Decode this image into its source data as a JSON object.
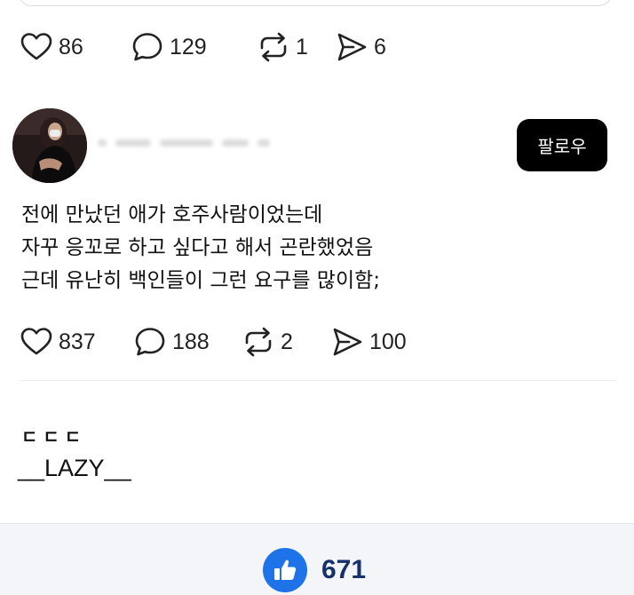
{
  "previous_post": {
    "actions": {
      "likes": "86",
      "comments": "129",
      "reposts": "1",
      "shares": "6"
    }
  },
  "post": {
    "follow_label": "팔로우",
    "lines": [
      "전에 만났던 애가 호주사람이었는데",
      "자꾸 응꼬로 하고 싶다고 해서 곤란했었음",
      "근데 유난히 백인들이 그런 요구를 많이함;"
    ],
    "actions": {
      "likes": "837",
      "comments": "188",
      "reposts": "2",
      "shares": "100"
    }
  },
  "comment": {
    "text": "ㄷㄷㄷ",
    "author": "__LAZY__"
  },
  "bottom_bar": {
    "like_count": "671",
    "accent_color": "#1e73e8"
  }
}
